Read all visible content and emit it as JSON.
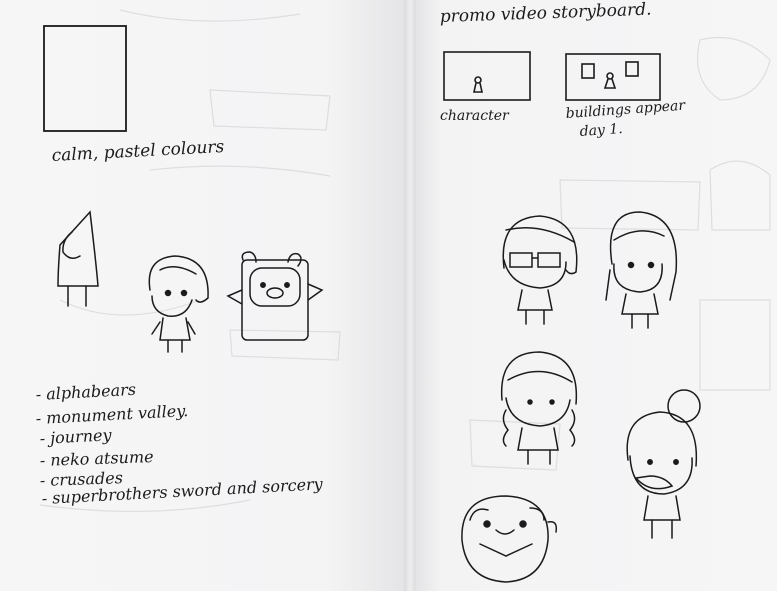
{
  "left_page": {
    "note": "calm, pastel colours",
    "references": [
      "- alphabears",
      "- monument valley.",
      "- journey",
      "- neko atsume",
      "- crusades",
      "- superbrothers sword and sorcery"
    ]
  },
  "right_page": {
    "title": "promo video storyboard.",
    "frames": [
      {
        "caption": "character"
      },
      {
        "caption": "buildings appear",
        "sub": "day 1."
      }
    ]
  },
  "colors": {
    "paper": "#f4f4f5",
    "ink": "#1b1b1d",
    "bleed": "#c9c9cc"
  }
}
